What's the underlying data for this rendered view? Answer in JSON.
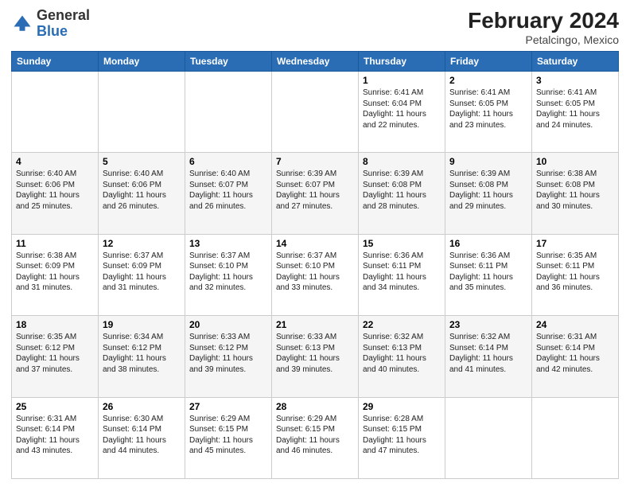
{
  "header": {
    "logo": {
      "general": "General",
      "blue": "Blue"
    },
    "title": "February 2024",
    "location": "Petalcingo, Mexico"
  },
  "days_of_week": [
    "Sunday",
    "Monday",
    "Tuesday",
    "Wednesday",
    "Thursday",
    "Friday",
    "Saturday"
  ],
  "weeks": [
    [
      {
        "day": "",
        "info": ""
      },
      {
        "day": "",
        "info": ""
      },
      {
        "day": "",
        "info": ""
      },
      {
        "day": "",
        "info": ""
      },
      {
        "day": "1",
        "info": "Sunrise: 6:41 AM\nSunset: 6:04 PM\nDaylight: 11 hours\nand 22 minutes."
      },
      {
        "day": "2",
        "info": "Sunrise: 6:41 AM\nSunset: 6:05 PM\nDaylight: 11 hours\nand 23 minutes."
      },
      {
        "day": "3",
        "info": "Sunrise: 6:41 AM\nSunset: 6:05 PM\nDaylight: 11 hours\nand 24 minutes."
      }
    ],
    [
      {
        "day": "4",
        "info": "Sunrise: 6:40 AM\nSunset: 6:06 PM\nDaylight: 11 hours\nand 25 minutes."
      },
      {
        "day": "5",
        "info": "Sunrise: 6:40 AM\nSunset: 6:06 PM\nDaylight: 11 hours\nand 26 minutes."
      },
      {
        "day": "6",
        "info": "Sunrise: 6:40 AM\nSunset: 6:07 PM\nDaylight: 11 hours\nand 26 minutes."
      },
      {
        "day": "7",
        "info": "Sunrise: 6:39 AM\nSunset: 6:07 PM\nDaylight: 11 hours\nand 27 minutes."
      },
      {
        "day": "8",
        "info": "Sunrise: 6:39 AM\nSunset: 6:08 PM\nDaylight: 11 hours\nand 28 minutes."
      },
      {
        "day": "9",
        "info": "Sunrise: 6:39 AM\nSunset: 6:08 PM\nDaylight: 11 hours\nand 29 minutes."
      },
      {
        "day": "10",
        "info": "Sunrise: 6:38 AM\nSunset: 6:08 PM\nDaylight: 11 hours\nand 30 minutes."
      }
    ],
    [
      {
        "day": "11",
        "info": "Sunrise: 6:38 AM\nSunset: 6:09 PM\nDaylight: 11 hours\nand 31 minutes."
      },
      {
        "day": "12",
        "info": "Sunrise: 6:37 AM\nSunset: 6:09 PM\nDaylight: 11 hours\nand 31 minutes."
      },
      {
        "day": "13",
        "info": "Sunrise: 6:37 AM\nSunset: 6:10 PM\nDaylight: 11 hours\nand 32 minutes."
      },
      {
        "day": "14",
        "info": "Sunrise: 6:37 AM\nSunset: 6:10 PM\nDaylight: 11 hours\nand 33 minutes."
      },
      {
        "day": "15",
        "info": "Sunrise: 6:36 AM\nSunset: 6:11 PM\nDaylight: 11 hours\nand 34 minutes."
      },
      {
        "day": "16",
        "info": "Sunrise: 6:36 AM\nSunset: 6:11 PM\nDaylight: 11 hours\nand 35 minutes."
      },
      {
        "day": "17",
        "info": "Sunrise: 6:35 AM\nSunset: 6:11 PM\nDaylight: 11 hours\nand 36 minutes."
      }
    ],
    [
      {
        "day": "18",
        "info": "Sunrise: 6:35 AM\nSunset: 6:12 PM\nDaylight: 11 hours\nand 37 minutes."
      },
      {
        "day": "19",
        "info": "Sunrise: 6:34 AM\nSunset: 6:12 PM\nDaylight: 11 hours\nand 38 minutes."
      },
      {
        "day": "20",
        "info": "Sunrise: 6:33 AM\nSunset: 6:12 PM\nDaylight: 11 hours\nand 39 minutes."
      },
      {
        "day": "21",
        "info": "Sunrise: 6:33 AM\nSunset: 6:13 PM\nDaylight: 11 hours\nand 39 minutes."
      },
      {
        "day": "22",
        "info": "Sunrise: 6:32 AM\nSunset: 6:13 PM\nDaylight: 11 hours\nand 40 minutes."
      },
      {
        "day": "23",
        "info": "Sunrise: 6:32 AM\nSunset: 6:14 PM\nDaylight: 11 hours\nand 41 minutes."
      },
      {
        "day": "24",
        "info": "Sunrise: 6:31 AM\nSunset: 6:14 PM\nDaylight: 11 hours\nand 42 minutes."
      }
    ],
    [
      {
        "day": "25",
        "info": "Sunrise: 6:31 AM\nSunset: 6:14 PM\nDaylight: 11 hours\nand 43 minutes."
      },
      {
        "day": "26",
        "info": "Sunrise: 6:30 AM\nSunset: 6:14 PM\nDaylight: 11 hours\nand 44 minutes."
      },
      {
        "day": "27",
        "info": "Sunrise: 6:29 AM\nSunset: 6:15 PM\nDaylight: 11 hours\nand 45 minutes."
      },
      {
        "day": "28",
        "info": "Sunrise: 6:29 AM\nSunset: 6:15 PM\nDaylight: 11 hours\nand 46 minutes."
      },
      {
        "day": "29",
        "info": "Sunrise: 6:28 AM\nSunset: 6:15 PM\nDaylight: 11 hours\nand 47 minutes."
      },
      {
        "day": "",
        "info": ""
      },
      {
        "day": "",
        "info": ""
      }
    ]
  ]
}
